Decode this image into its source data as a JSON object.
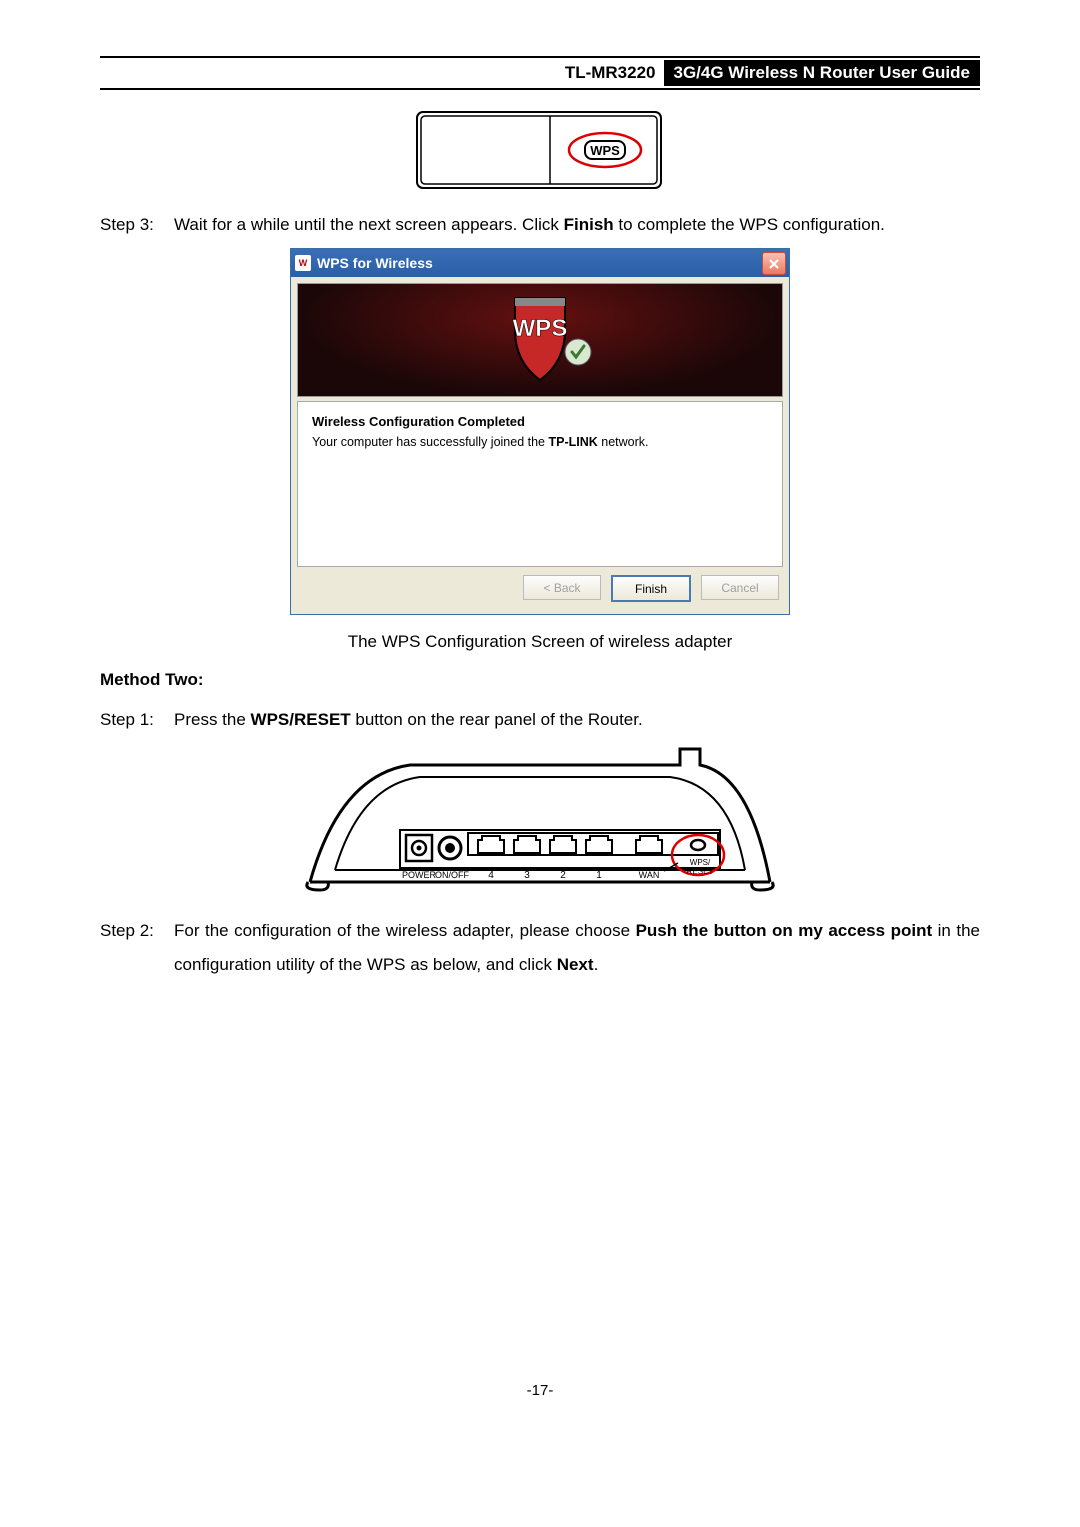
{
  "header": {
    "model": "TL-MR3220",
    "title": "3G/4G Wireless N Router User Guide"
  },
  "wps_button_label": "WPS",
  "step3": {
    "label": "Step 3:",
    "text_pre": "Wait for a while until the next screen appears. Click ",
    "bold": "Finish",
    "text_post": " to complete the WPS configuration."
  },
  "dialog": {
    "title": "WPS for Wireless",
    "banner_text": "WPS",
    "content_title": "Wireless Configuration Completed",
    "content_line_pre": "Your computer has successfully joined the ",
    "content_bold": "TP-LINK",
    "content_line_post": " network.",
    "btn_back": "< Back",
    "btn_finish": "Finish",
    "btn_cancel": "Cancel"
  },
  "dialog_caption": "The WPS Configuration Screen of wireless adapter",
  "method_two_title": "Method Two:",
  "step1": {
    "label": "Step 1:",
    "pre": "Press the ",
    "bold": "WPS/RESET",
    "post": " button on the rear panel of the Router."
  },
  "rear_labels": {
    "power": "POWER",
    "onoff": "ON/OFF",
    "p4": "4",
    "p3": "3",
    "p2": "2",
    "p1": "1",
    "wan": "WAN",
    "wps_top": "WPS/",
    "wps_bot": "RESET"
  },
  "step2": {
    "label": "Step 2:",
    "pre": "For the configuration of the wireless adapter, please choose ",
    "bold1": "Push the button on my access point",
    "mid": " in the configuration utility of the WPS as below, and click ",
    "bold2": "Next",
    "post": "."
  },
  "page_number": "-17-"
}
